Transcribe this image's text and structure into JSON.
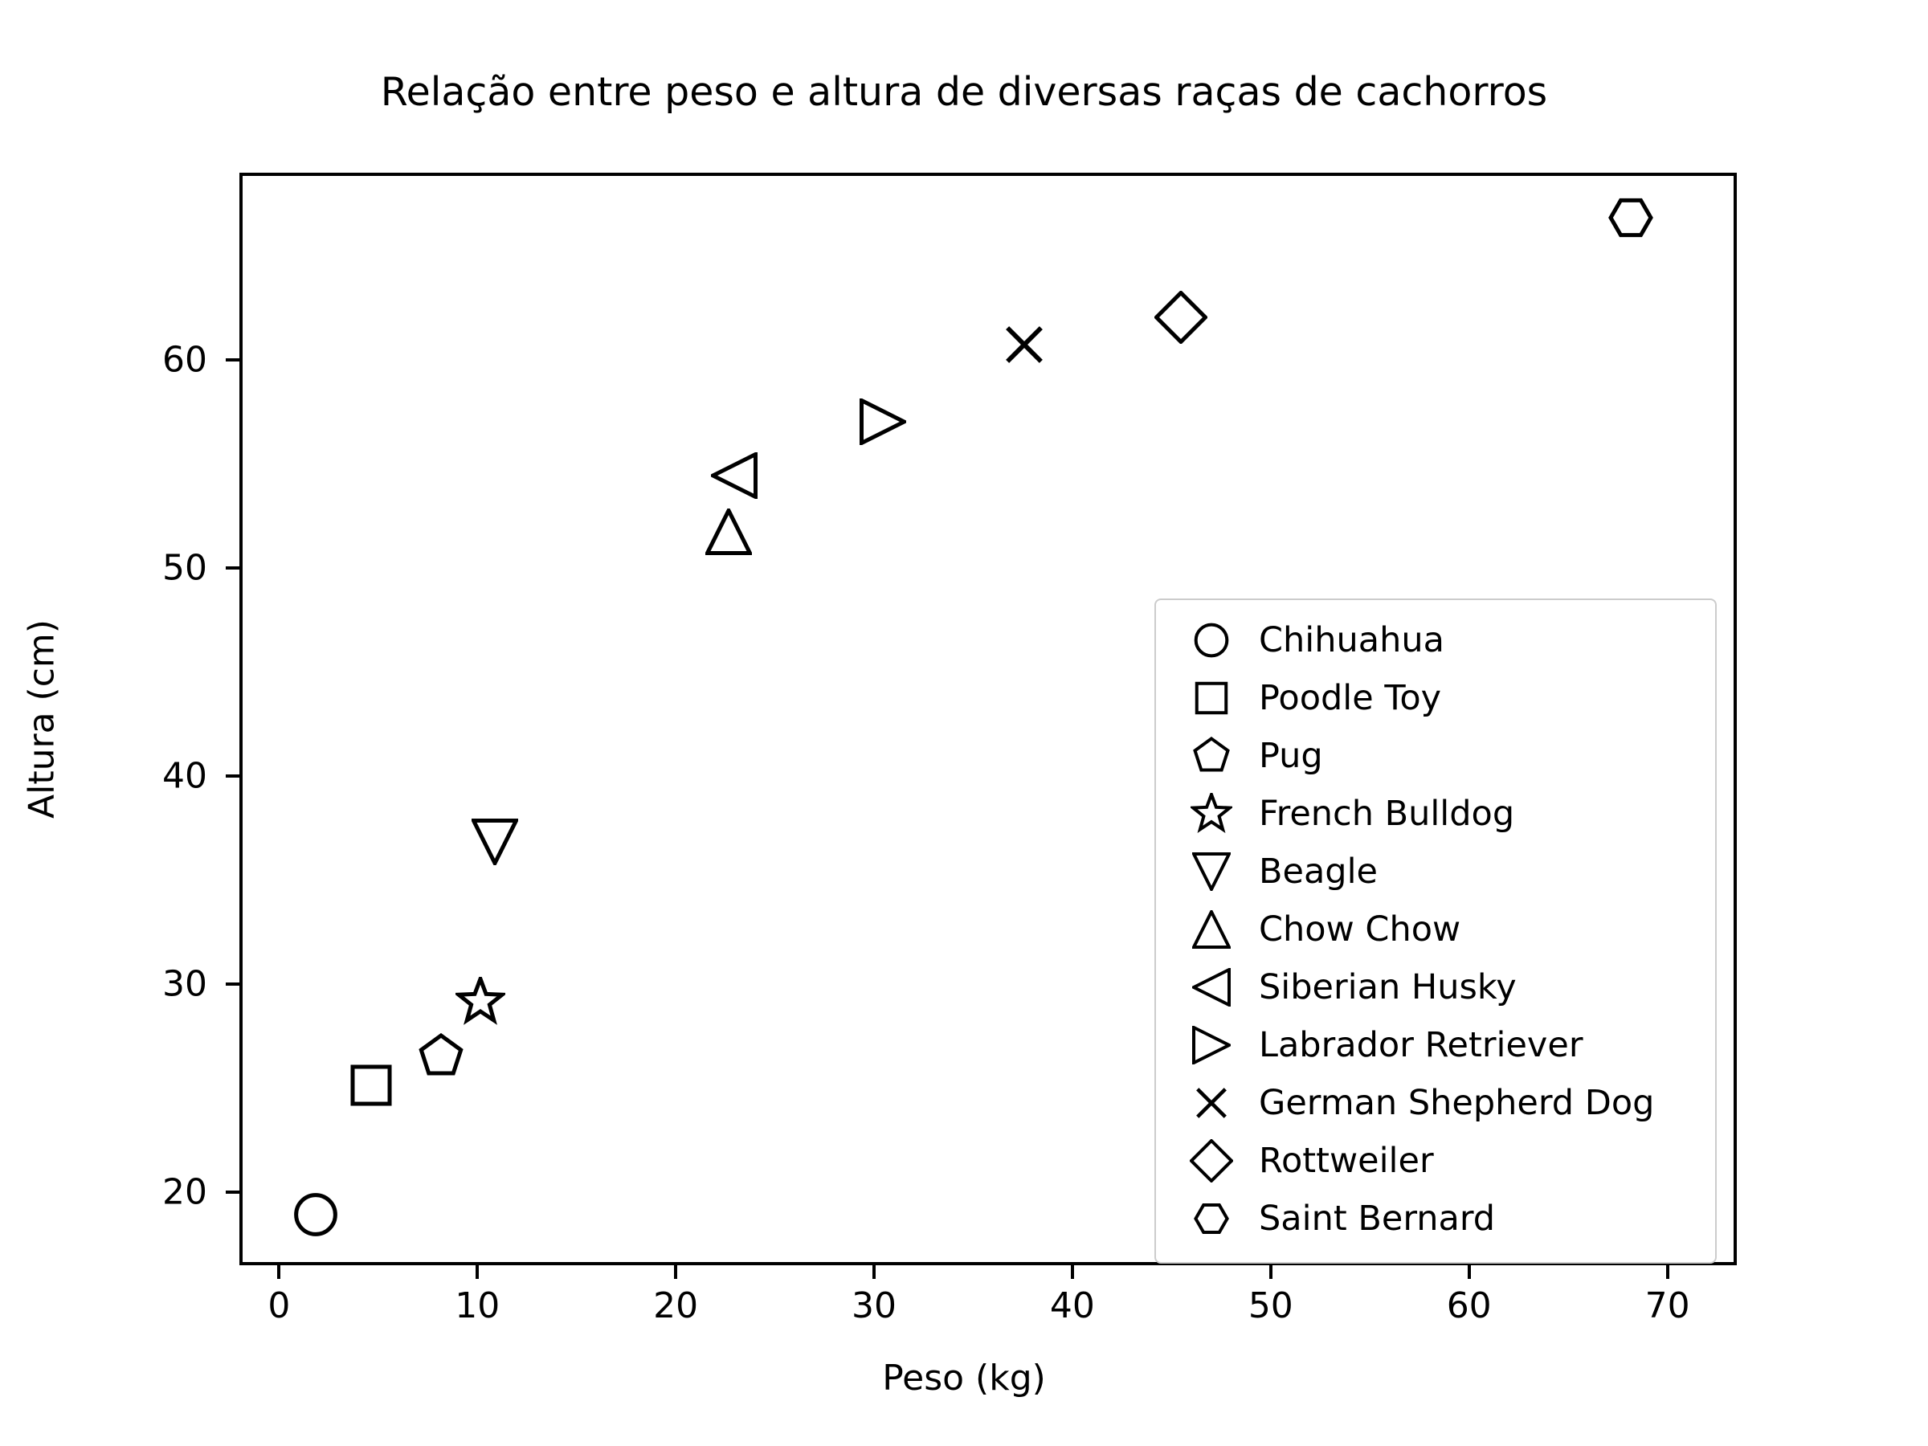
{
  "chart_data": {
    "type": "scatter",
    "title": "Relação entre peso e altura de diversas raças de cachorros",
    "xlabel": "Peso (kg)",
    "ylabel": "Altura (cm)",
    "xlim": [
      -2.0,
      73.5
    ],
    "ylim": [
      16.5,
      69.0
    ],
    "xticks": [
      0,
      10,
      20,
      30,
      40,
      50,
      60,
      70
    ],
    "yticks": [
      20,
      30,
      40,
      50,
      60
    ],
    "xtick_labels": [
      "0",
      "10",
      "20",
      "30",
      "40",
      "50",
      "60",
      "70"
    ],
    "ytick_labels": [
      "20",
      "30",
      "40",
      "50",
      "60"
    ],
    "grid": false,
    "legend_position": "center right",
    "marker_color": "#000000",
    "series": [
      {
        "name": "Chihuahua",
        "marker": "circle",
        "x": 1.7,
        "y": 19.1
      },
      {
        "name": "Poodle Toy",
        "marker": "square",
        "x": 4.5,
        "y": 25.3
      },
      {
        "name": "Pug",
        "marker": "pentagon",
        "x": 8.0,
        "y": 26.7
      },
      {
        "name": "French Bulldog",
        "marker": "star",
        "x": 10.0,
        "y": 29.3
      },
      {
        "name": "Beagle",
        "marker": "triangle-down",
        "x": 10.7,
        "y": 37.0
      },
      {
        "name": "Chow Chow",
        "marker": "triangle-up",
        "x": 22.5,
        "y": 51.9
      },
      {
        "name": "Siberian Husky",
        "marker": "triangle-left",
        "x": 22.8,
        "y": 54.6
      },
      {
        "name": "Labrador Retriever",
        "marker": "triangle-right",
        "x": 30.3,
        "y": 57.2
      },
      {
        "name": "German Shepherd Dog",
        "marker": "x",
        "x": 37.4,
        "y": 60.9
      },
      {
        "name": "Rottweiler",
        "marker": "diamond",
        "x": 45.3,
        "y": 62.2
      },
      {
        "name": "Saint Bernard",
        "marker": "hexagon",
        "x": 68.0,
        "y": 67.0
      }
    ]
  },
  "legend": {
    "items": [
      {
        "label": "Chihuahua",
        "marker": "circle"
      },
      {
        "label": "Poodle Toy",
        "marker": "square"
      },
      {
        "label": "Pug",
        "marker": "pentagon"
      },
      {
        "label": "French Bulldog",
        "marker": "star"
      },
      {
        "label": "Beagle",
        "marker": "triangle-down"
      },
      {
        "label": "Chow Chow",
        "marker": "triangle-up"
      },
      {
        "label": "Siberian Husky",
        "marker": "triangle-left"
      },
      {
        "label": "Labrador Retriever",
        "marker": "triangle-right"
      },
      {
        "label": "German Shepherd Dog",
        "marker": "x"
      },
      {
        "label": "Rottweiler",
        "marker": "diamond"
      },
      {
        "label": "Saint Bernard",
        "marker": "hexagon"
      }
    ]
  }
}
